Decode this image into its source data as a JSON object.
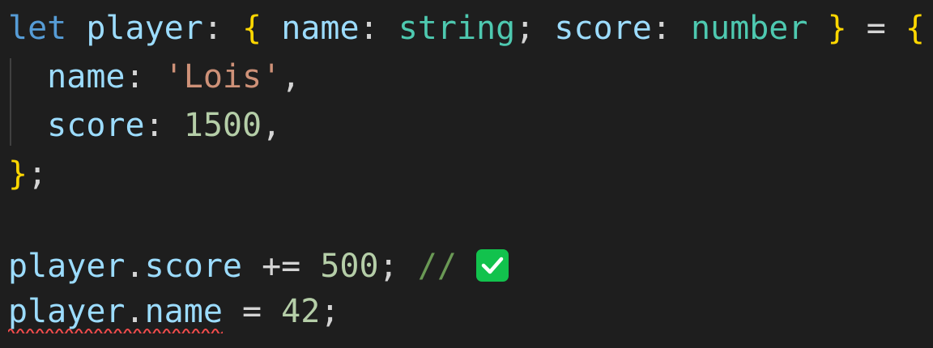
{
  "code": {
    "line1": {
      "kw_let": "let",
      "var_player": "player",
      "colon1": ": ",
      "brace_open": "{",
      "space1": " ",
      "prop_name": "name",
      "colon2": ": ",
      "type_string": "string",
      "semi1": "; ",
      "prop_score": "score",
      "colon3": ": ",
      "type_number": "number",
      "space2": " ",
      "brace_close": "}",
      "eq": " = ",
      "brace_open2": "{"
    },
    "line2": {
      "prop_name": "name",
      "colon": ": ",
      "value": "'Lois'",
      "comma": ","
    },
    "line3": {
      "prop_score": "score",
      "colon": ": ",
      "value": "1500",
      "comma": ","
    },
    "line4": {
      "brace_close": "}",
      "semi": ";"
    },
    "line6": {
      "var_player": "player",
      "dot": ".",
      "prop_score": "score",
      "op": " += ",
      "value": "500",
      "semi": ";",
      "comment": " // ",
      "icon": "check-mark-icon"
    },
    "line7": {
      "var_player": "player",
      "dot": ".",
      "prop_name": "name",
      "op": " = ",
      "value": "42",
      "semi": ";",
      "error": "squiggle-underline"
    }
  },
  "colors": {
    "background": "#1e1e1e",
    "keyword": "#569cd6",
    "variable": "#9cdcfe",
    "type": "#4ec9b0",
    "string": "#ce9178",
    "number": "#b5cea8",
    "brace": "#ffd700",
    "comment": "#6a9955",
    "check_icon": "#12c24d",
    "error_squiggle": "#f14c4c"
  }
}
